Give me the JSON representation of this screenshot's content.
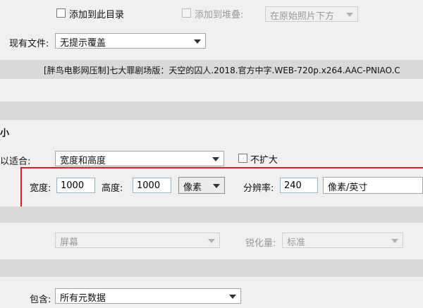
{
  "top_row": {
    "add_to_catalog_label": "添加到此目录",
    "add_to_stack_label": "添加到堆叠:",
    "stack_position_value": "在原始照片下方"
  },
  "existing_files": {
    "label": "现有文件:",
    "value": "无提示覆盖"
  },
  "filename_band": {
    "text": "[胖鸟电影网压制]七大罪剧场版：天空的囚人.2018.官方中字.WEB-720p.x264.AAC-PNIAO.C"
  },
  "size_section": {
    "header": "小",
    "fit_label": "以适合:",
    "fit_value": "宽度和高度",
    "no_enlarge_label": "不扩大",
    "width_label": "宽度:",
    "width_value": "1000",
    "height_label": "高度:",
    "height_value": "1000",
    "unit_value": "像素",
    "resolution_label": "分辨率:",
    "resolution_value": "240",
    "resolution_unit_value": "像素/英寸"
  },
  "sharpen_row": {
    "target_value": "屏幕",
    "amount_label": "锐化量:",
    "amount_value": "标准"
  },
  "metadata": {
    "include_label": "包含:",
    "include_value": "所有元数据"
  }
}
